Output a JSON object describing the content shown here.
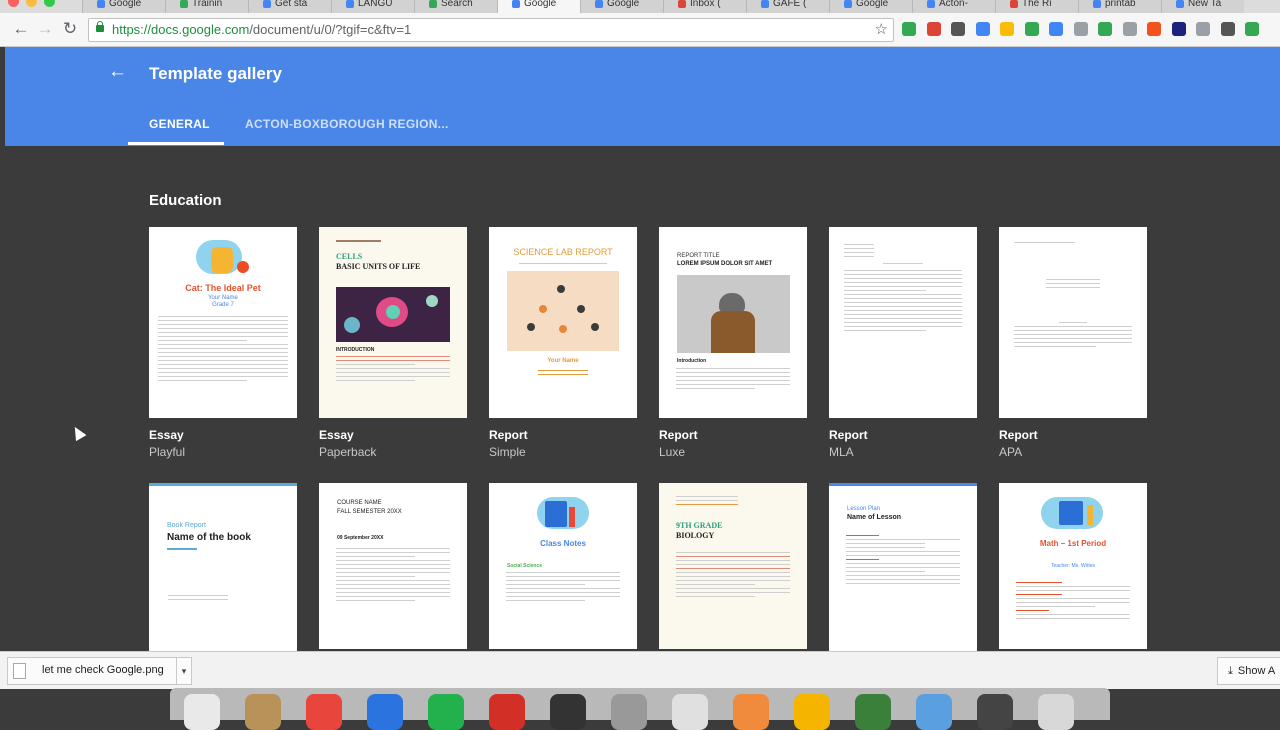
{
  "browser": {
    "tabs": [
      {
        "label": "Google",
        "color": "#4285f4"
      },
      {
        "label": "Trainin",
        "color": "#34a853"
      },
      {
        "label": "Get sta",
        "color": "#4285f4"
      },
      {
        "label": "LANGU",
        "color": "#4285f4"
      },
      {
        "label": "Search",
        "color": "#34a853"
      },
      {
        "label": "Google",
        "color": "#4285f4"
      },
      {
        "label": "Google",
        "color": "#4285f4"
      },
      {
        "label": "Inbox (",
        "color": "#db4437"
      },
      {
        "label": "GAFE (",
        "color": "#4285f4"
      },
      {
        "label": "Google",
        "color": "#4285f4"
      },
      {
        "label": "Acton-",
        "color": "#4285f4"
      },
      {
        "label": "The Ri",
        "color": "#db4437"
      },
      {
        "label": "printab",
        "color": "#4285f4"
      },
      {
        "label": "New Ta",
        "color": "#4285f4"
      }
    ],
    "url_host": "https://docs.google.com",
    "url_path": "/document/u/0/?tgif=c&ftv=1"
  },
  "header": {
    "title": "Template gallery",
    "tab_general": "GENERAL",
    "tab_acton": "ACTON-BOXBOROUGH REGION..."
  },
  "education": {
    "section_title": "Education",
    "row1": [
      {
        "type": "Essay",
        "style": "Playful",
        "card_title": "Cat: The Ideal Pet",
        "card_sub1": "Your Name",
        "card_sub2": "Grade 7"
      },
      {
        "type": "Essay",
        "style": "Paperback",
        "card_title": "CELLS",
        "card_sub1": "BASIC UNITS OF LIFE",
        "card_sub2": "INTRODUCTION"
      },
      {
        "type": "Report",
        "style": "Simple",
        "card_title": "SCIENCE LAB REPORT",
        "card_sub1": "Your Name",
        "card_sub2": ""
      },
      {
        "type": "Report",
        "style": "Luxe",
        "card_title": "REPORT TITLE",
        "card_sub1": "LOREM IPSUM DOLOR SIT AMET",
        "card_sub2": "Introduction"
      },
      {
        "type": "Report",
        "style": "MLA",
        "card_title": "",
        "card_sub1": "",
        "card_sub2": ""
      },
      {
        "type": "Report",
        "style": "APA",
        "card_title": "",
        "card_sub1": "",
        "card_sub2": ""
      }
    ],
    "row2": [
      {
        "card_title": "Book Report",
        "card_sub1": "Name of the book"
      },
      {
        "card_title": "COURSE NAME",
        "card_sub1": "FALL SEMESTER 20XX",
        "card_sub2": "09 September 20XX"
      },
      {
        "card_title": "Class Notes",
        "card_sub1": "Social Science"
      },
      {
        "card_title": "9TH GRADE",
        "card_sub1": "BIOLOGY"
      },
      {
        "card_title": "Lesson Plan",
        "card_sub1": "Name of Lesson"
      },
      {
        "card_title": "Math – 1st Period",
        "card_sub1": "Teacher: Ms. Writes"
      }
    ]
  },
  "downloads": {
    "file_name": "let me check Google.png",
    "show_all": "Show A"
  },
  "colors": {
    "header": "#4a86e8",
    "body_bg": "#3b3b3b",
    "dock_icons": [
      "#e9e9e9",
      "#b89258",
      "#e8453c",
      "#2b74e0",
      "#22b14c",
      "#d22f27",
      "#333333",
      "#999999",
      "#e0e0e0",
      "#f08a3c",
      "#f5b400",
      "#3a7f3a",
      "#5aa0e0",
      "#444444",
      "#d8d8d8"
    ]
  }
}
